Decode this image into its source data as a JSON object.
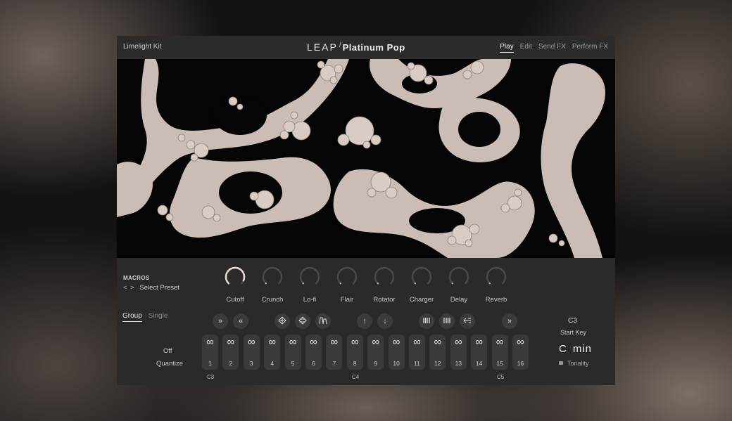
{
  "header": {
    "kit_name": "Limelight Kit",
    "logo_primary": "LEAP",
    "logo_slash": "/",
    "logo_secondary": "Platinum Pop",
    "nav": [
      {
        "label": "Play",
        "active": true
      },
      {
        "label": "Edit",
        "active": false
      },
      {
        "label": "Send FX",
        "active": false
      },
      {
        "label": "Perform FX",
        "active": false
      }
    ]
  },
  "macros": {
    "title": "MACROS",
    "preset_arrows": "< >",
    "preset_label": "Select Preset",
    "knobs": [
      {
        "label": "Cutoff",
        "value": 0.92
      },
      {
        "label": "Crunch",
        "value": 0.0
      },
      {
        "label": "Lo-fi",
        "value": 0.0
      },
      {
        "label": "Flair",
        "value": 0.0
      },
      {
        "label": "Rotator",
        "value": 0.0
      },
      {
        "label": "Charger",
        "value": 0.0
      },
      {
        "label": "Delay",
        "value": 0.0
      },
      {
        "label": "Reverb",
        "value": 0.0
      }
    ]
  },
  "mode_tabs": {
    "group": "Group",
    "single": "Single"
  },
  "quantize": {
    "value": "Off",
    "label": "Quantize"
  },
  "pad_controls": [
    {
      "name": "fast-forward-icon",
      "glyph": "»"
    },
    {
      "name": "rewind-icon",
      "glyph": "«"
    },
    {
      "name": "texture-a-icon",
      "glyph": ""
    },
    {
      "name": "texture-b-icon",
      "glyph": ""
    },
    {
      "name": "envelope-icon",
      "glyph": ""
    },
    {
      "name": "pitch-up-icon",
      "glyph": "↑"
    },
    {
      "name": "pitch-down-icon",
      "glyph": "↓"
    },
    {
      "name": "slice-a-icon",
      "glyph": ""
    },
    {
      "name": "slice-b-icon",
      "glyph": ""
    },
    {
      "name": "reverse-icon",
      "glyph": ""
    },
    {
      "name": "skip-icon",
      "glyph": "»"
    }
  ],
  "pads": [
    {
      "num": "1",
      "symbol": "∞"
    },
    {
      "num": "2",
      "symbol": "∞"
    },
    {
      "num": "3",
      "symbol": "∞"
    },
    {
      "num": "4",
      "symbol": "∞"
    },
    {
      "num": "5",
      "symbol": "∞"
    },
    {
      "num": "6",
      "symbol": "∞"
    },
    {
      "num": "7",
      "symbol": "∞"
    },
    {
      "num": "8",
      "symbol": "∞"
    },
    {
      "num": "9",
      "symbol": "∞"
    },
    {
      "num": "10",
      "symbol": "∞"
    },
    {
      "num": "11",
      "symbol": "∞"
    },
    {
      "num": "12",
      "symbol": "∞"
    },
    {
      "num": "13",
      "symbol": "∞"
    },
    {
      "num": "14",
      "symbol": "∞"
    },
    {
      "num": "15",
      "symbol": "∞"
    },
    {
      "num": "16",
      "symbol": "∞"
    }
  ],
  "octave_labels": [
    "C3",
    "C4",
    "C5"
  ],
  "start_key": {
    "value": "C3",
    "label": "Start Key"
  },
  "tonality": {
    "key": "C",
    "scale": "min",
    "label": "Tonality"
  },
  "colors": {
    "knob_active": "#e6d8d0",
    "knob_track": "#4a4a4a",
    "art_fill": "#cfc1b9"
  }
}
